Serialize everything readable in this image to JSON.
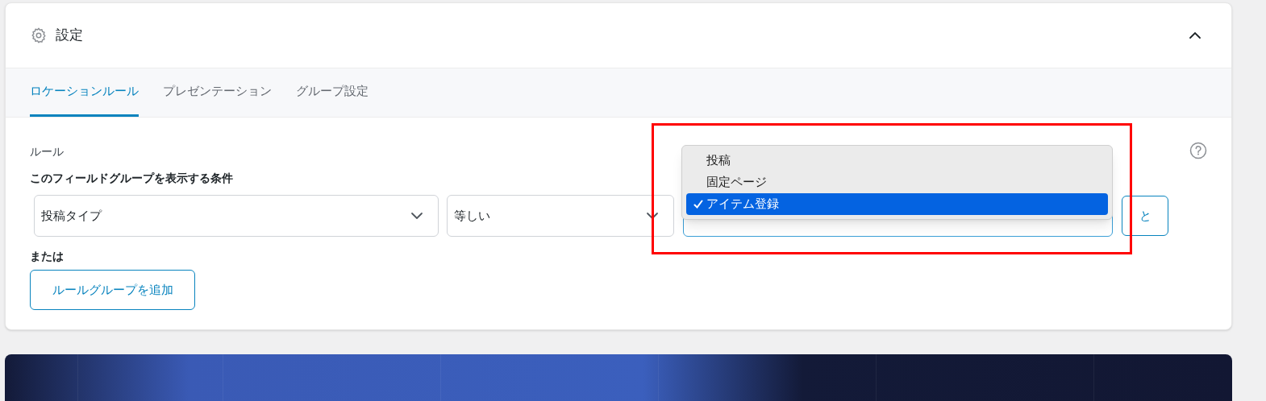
{
  "panel": {
    "title": "設定",
    "expanded": true
  },
  "tabs": [
    {
      "label": "ロケーションルール",
      "selected": true
    },
    {
      "label": "プレゼンテーション",
      "selected": false
    },
    {
      "label": "グループ設定",
      "selected": false
    }
  ],
  "rules": {
    "label": "ルール",
    "condition_label": "このフィールドグループを表示する条件",
    "param": {
      "value": "投稿タイプ"
    },
    "operator": {
      "value": "等しい"
    },
    "value_options": [
      {
        "label": "投稿",
        "selected": false
      },
      {
        "label": "固定ページ",
        "selected": false
      },
      {
        "label": "アイテム登録",
        "selected": true
      }
    ],
    "and_button": "と",
    "or_label": "または",
    "add_group_button": "ルールグループを追加"
  }
}
